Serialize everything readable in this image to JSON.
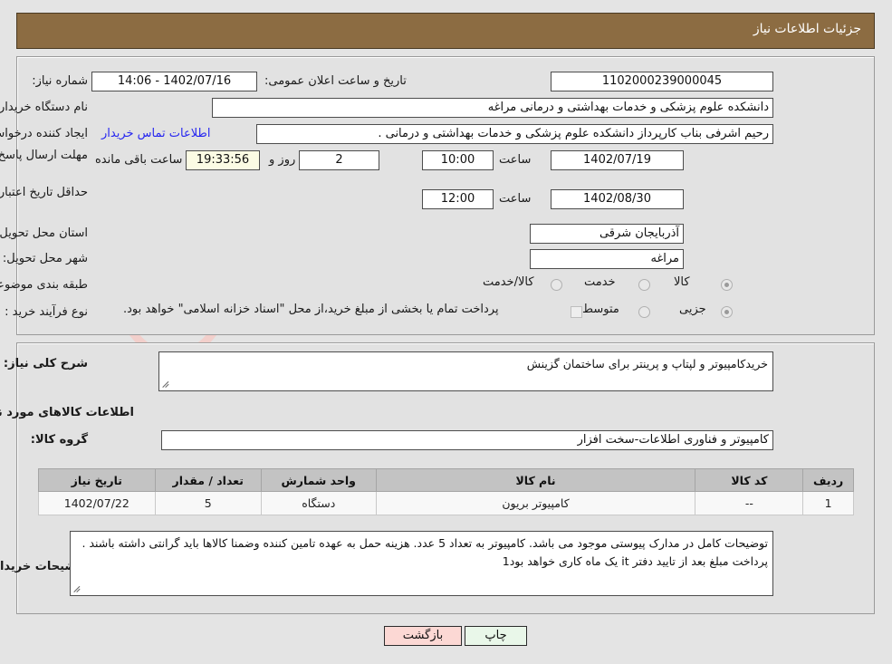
{
  "header": {
    "title": "جزئیات اطلاعات نیاز"
  },
  "main": {
    "need_number_label": "شماره نیاز:",
    "need_number_value": "1102000239000045",
    "announce_datetime_label": "تاریخ و ساعت اعلان عمومی:",
    "announce_datetime_value": "1402/07/16 - 14:06",
    "buyer_org_label": "نام دستگاه خریدار:",
    "buyer_org_value": "دانشکده علوم پزشکی و خدمات بهداشتی و درمانی مراغه",
    "requester_label": "ایجاد کننده درخواست:",
    "requester_value": "رحیم اشرفی بناب کارپرداز دانشکده علوم پزشکی و خدمات بهداشتی و درمانی .",
    "contact_link": "اطلاعات تماس خریدار",
    "response_deadline_label": "مهلت ارسال پاسخ: تا تاریخ:",
    "response_deadline_date": "1402/07/19",
    "response_deadline_hour_label": "ساعت",
    "response_deadline_hour": "10:00",
    "remaining_days": "2",
    "remaining_days_label": "روز و",
    "remaining_time": "19:33:56",
    "remaining_suffix_label": "ساعت باقی مانده",
    "price_validity_label": "حداقل تاریخ اعتبار قیمت: تا تاریخ:",
    "price_validity_date": "1402/08/30",
    "price_validity_hour_label": "ساعت",
    "price_validity_hour": "12:00",
    "province_label": "استان محل تحویل:",
    "province_value": "آذربایجان شرقی",
    "city_label": "شهر محل تحویل:",
    "city_value": "مراغه",
    "category_label": "طبقه بندی موضوعی:",
    "category_options": [
      "کالا",
      "خدمت",
      "کالا/خدمت"
    ],
    "category_selected": "کالا",
    "process_type_label": "نوع فرآیند خرید :",
    "process_type_options": [
      "جزیی",
      "متوسط"
    ],
    "process_type_selected": "جزیی",
    "treasury_note": "پرداخت تمام یا بخشی از مبلغ خرید،از محل \"اسناد خزانه اسلامی\" خواهد بود."
  },
  "details": {
    "general_desc_label": "شرح کلی نیاز:",
    "general_desc_value": "خریدکامپیوتر و لپتاپ و پرینتر برای ساختمان گزینش",
    "goods_info_title": "اطلاعات کالاهای مورد نیاز",
    "goods_group_label": "گروه کالا:",
    "goods_group_value": "کامپیوتر و فناوری اطلاعات-سخت افزار",
    "table": {
      "headers": [
        "ردیف",
        "کد کالا",
        "نام کالا",
        "واحد شمارش",
        "تعداد / مقدار",
        "تاریخ نیاز"
      ],
      "rows": [
        {
          "row": "1",
          "code": "--",
          "name": "کامپیوتر بریون",
          "unit": "دستگاه",
          "qty": "5",
          "need_date": "1402/07/22"
        }
      ]
    },
    "buyer_notes_label": "توضیحات خریدار:",
    "buyer_notes_value": "توضیحات کامل در مدارک پیوستی موجود می باشد. کامپیوتر به تعداد 5 عدد. هزینه حمل به عهده تامین کننده وضمنا کالاها باید گرانتی داشته باشند . پرداخت مبلغ بعد از تایید دفتر it  یک ماه کاری خواهد بود1"
  },
  "footer": {
    "print_label": "چاپ",
    "back_label": "بازگشت"
  },
  "watermark": {
    "text": "AriaTender.net"
  },
  "colors": {
    "header_brown": "#8c6c42",
    "page_bg": "#e4e4e4",
    "panel_bg": "#e2e2e2",
    "link_blue": "#2626f0",
    "timer_bg": "#fbfbe4",
    "table_header_bg": "#c3c3c3",
    "print_btn_bg": "#e9f7e9",
    "back_btn_bg": "#fcd8d4"
  }
}
